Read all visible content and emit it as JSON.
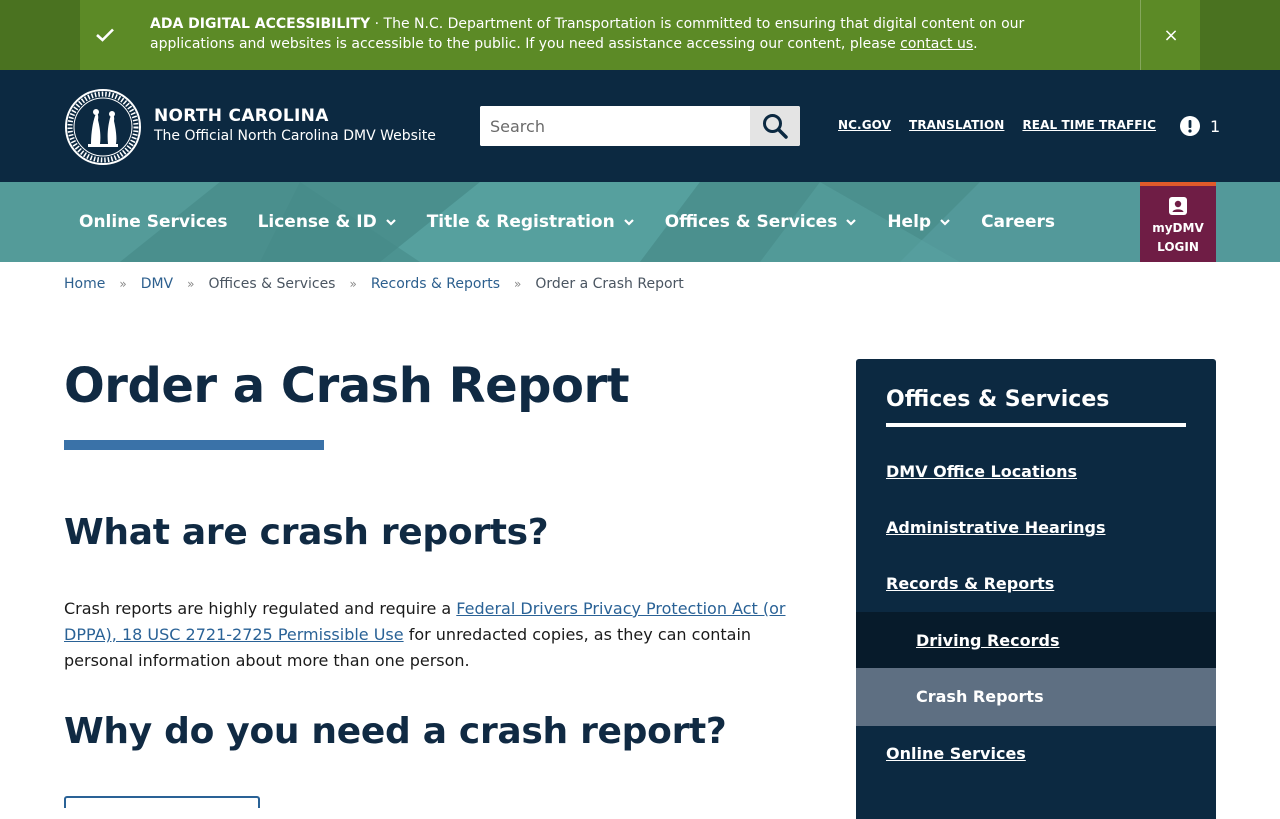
{
  "alert": {
    "title": "ADA DIGITAL ACCESSIBILITY",
    "separator": " · ",
    "message": "The N.C. Department of Transportation is committed to ensuring that digital content on our applications and websites is accessible to the public. If you need assistance accessing our content, please ",
    "link_text": "contact us",
    "end": ".",
    "close_label": "×"
  },
  "header": {
    "brand_name": "NORTH CAROLINA",
    "brand_sub": "The Official North Carolina DMV Website",
    "search_placeholder": "Search",
    "util_links": [
      "NC.GOV",
      "TRANSLATION",
      "REAL TIME TRAFFIC"
    ],
    "notification_count": "1"
  },
  "nav": {
    "items": [
      {
        "label": "Online Services",
        "dropdown": false
      },
      {
        "label": "License & ID",
        "dropdown": true
      },
      {
        "label": "Title & Registration",
        "dropdown": true
      },
      {
        "label": "Offices & Services",
        "dropdown": true
      },
      {
        "label": "Help",
        "dropdown": true
      },
      {
        "label": "Careers",
        "dropdown": false
      }
    ],
    "mydmv_line1": "myDMV",
    "mydmv_line2": "LOGIN"
  },
  "breadcrumb": {
    "items": [
      "Home",
      "DMV",
      "Offices & Services",
      "Records & Reports"
    ],
    "separator": "»",
    "current": "Order a Crash Report"
  },
  "main": {
    "title": "Order a Crash Report",
    "section1_heading": "What are crash reports?",
    "para_before": "Crash reports are highly regulated and require a ",
    "para_link": "Federal Drivers Privacy Protection Act (or DPPA), 18 USC 2721-2725 Permissible Use",
    "para_after": " for unredacted copies, as they can contain personal information about more than one person.",
    "section2_heading": "Why do you need a crash report?"
  },
  "sidebar": {
    "title": "Offices & Services",
    "links": [
      "DMV Office Locations",
      "Administrative Hearings",
      "Records & Reports"
    ],
    "sub_links": [
      "Driving Records"
    ],
    "active": "Crash Reports",
    "after_links": [
      "Online Services"
    ]
  },
  "colors": {
    "alert_green": "#5c8a26",
    "header_navy": "#0c2941",
    "nav_teal": "#4e9593",
    "mydmv_maroon": "#6f1d45",
    "accent_blue": "#3a72a8"
  }
}
